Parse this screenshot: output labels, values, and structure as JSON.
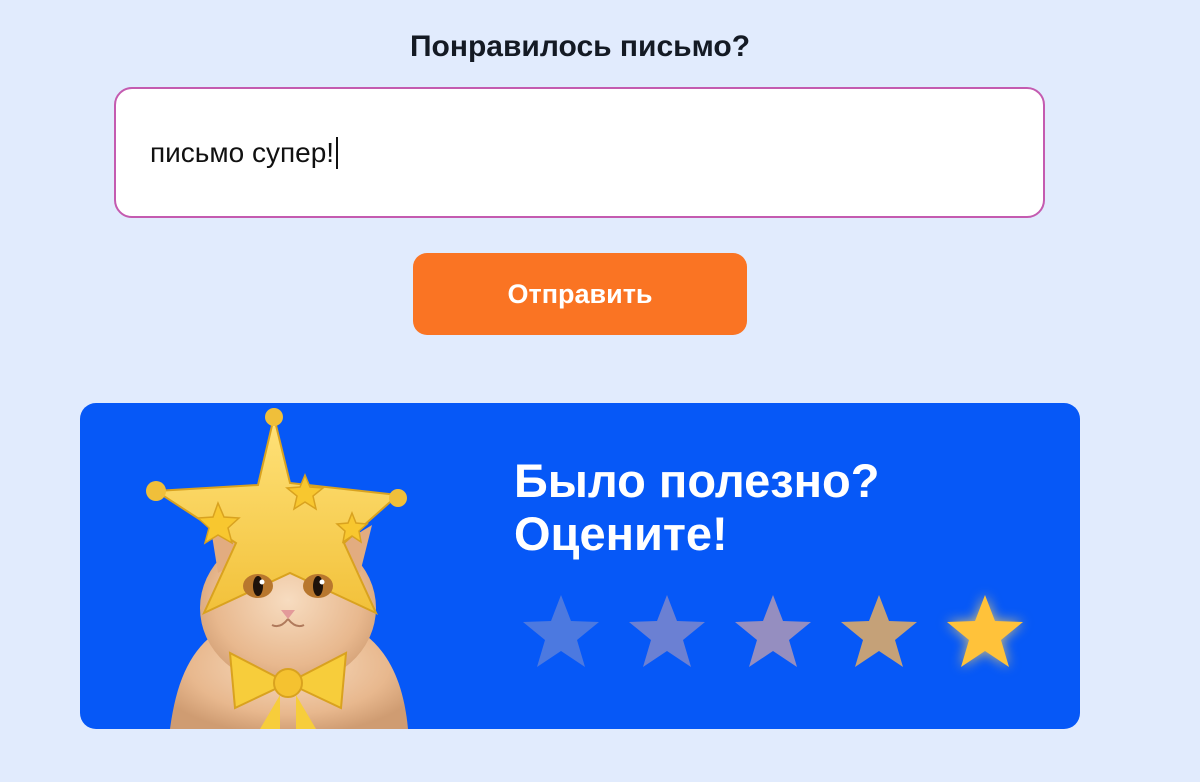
{
  "feedback": {
    "question": "Понравилось письмо?",
    "input_value": "письмо супер!",
    "submit_label": "Отправить"
  },
  "banner": {
    "title_line1": "Было полезно?",
    "title_line2": "Оцените!",
    "rating_max": 5,
    "star_colors": [
      "#4c79e0",
      "#6b80d3",
      "#958ec0",
      "#c5a178",
      "#ffc23a"
    ],
    "background_color": "#0658f7",
    "image": "cat-in-yellow-star-hat"
  },
  "colors": {
    "page_background": "#e1ebfd",
    "input_border": "#c45bb0",
    "submit_button": "#fa7423"
  }
}
